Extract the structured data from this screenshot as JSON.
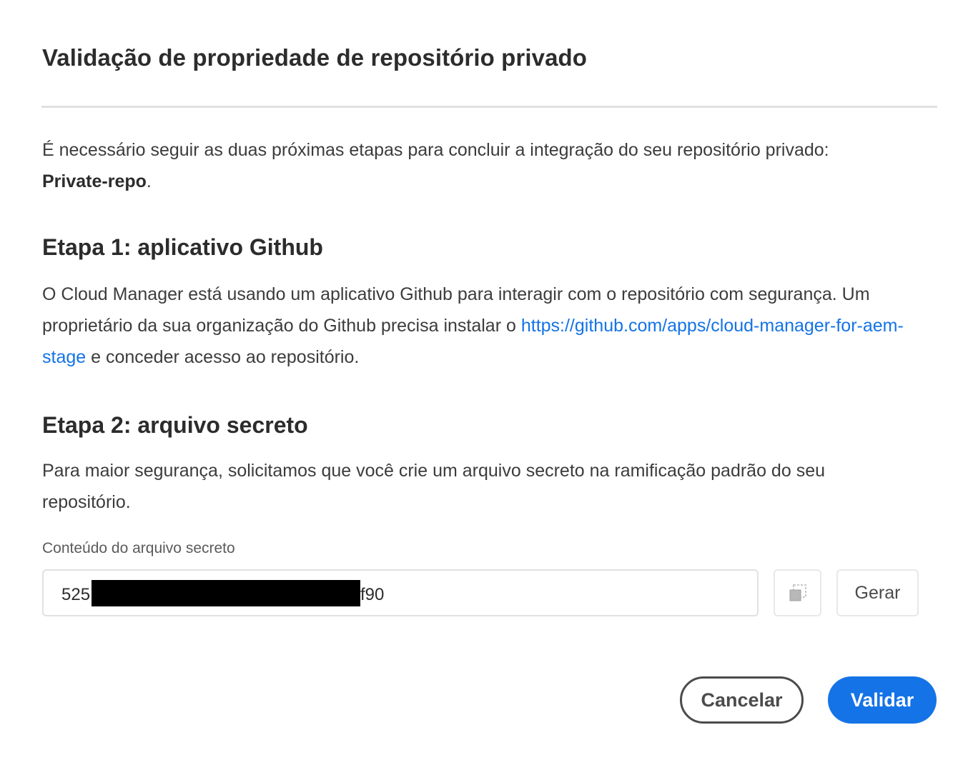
{
  "dialog": {
    "title": "Validação de propriedade de repositório privado",
    "intro_text": "É necessário seguir as duas próximas etapas para concluir a integração do seu repositório privado:",
    "repo_name": "Private-repo",
    "intro_end": ".",
    "step1": {
      "heading": "Etapa 1: aplicativo Github",
      "text_before_link": "O Cloud Manager está usando um aplicativo Github para interagir com o repositório com segurança. Um proprietário da sua organização do Github precisa instalar o ",
      "link_text": "https://github.com/apps/cloud-manager-for-aem-stage",
      "text_after_link": " e conceder acesso ao repositório."
    },
    "step2": {
      "heading": "Etapa 2: arquivo secreto",
      "text": "Para maior segurança, solicitamos que você crie um arquivo secreto na ramificação padrão do seu repositório."
    },
    "secret_field": {
      "label": "Conteúdo do arquivo secreto",
      "value_start": "525",
      "value_end": "f90"
    },
    "copy_icon": "copy-icon",
    "generate_label": "Gerar",
    "cancel_label": "Cancelar",
    "validate_label": "Validar",
    "colors": {
      "accent": "#1473e6",
      "text": "#2c2c2c",
      "divider": "#e1e1e1"
    }
  }
}
